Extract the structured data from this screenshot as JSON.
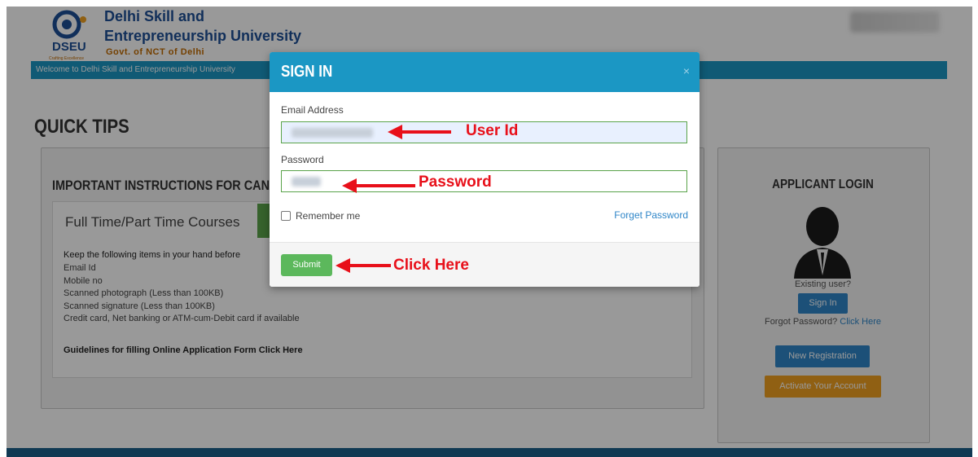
{
  "header": {
    "logo_text": "DSEU",
    "logo_tagline": "Crafting Excellence",
    "brand_line1": "Delhi Skill and",
    "brand_line2": "Entrepreneurship University",
    "brand_line3": "Govt. of NCT of Delhi",
    "welcome": "Welcome to Delhi Skill and Entrepreneurship University"
  },
  "main": {
    "quick_tips": "QUICK TIPS",
    "instructions_title": "IMPORTANT INSTRUCTIONS FOR CANDIDATE",
    "courses_title": "Full Time/Part Time Courses",
    "keep_line": "Keep the following items in your hand before",
    "requirements": [
      "Email Id",
      "Mobile no",
      "Scanned photograph (Less than 100KB)",
      "Scanned signature (Less than 100KB)",
      "Credit card, Net banking or ATM-cum-Debit card if available"
    ],
    "guidelines": "Guidelines for filling Online Application Form Click Here"
  },
  "applicant": {
    "title": "APPLICANT LOGIN",
    "existing": "Existing user?",
    "signin": "Sign In",
    "forgot_prefix": "Forgot Password? ",
    "forgot_link": "Click Here",
    "new_registration": "New Registration",
    "activate": "Activate Your Account"
  },
  "modal": {
    "title": "SIGN IN",
    "close": "×",
    "email_label": "Email Address",
    "password_label": "Password",
    "remember": "Remember me",
    "forget": "Forget Password",
    "submit": "Submit"
  },
  "annotations": {
    "user_id": "User Id",
    "password": "Password",
    "click_here": "Click Here",
    "color": "#e8101a"
  },
  "colors": {
    "header_blue": "#1b97c4",
    "button_blue": "#2f86c8",
    "submit_green": "#5cb85c",
    "activate_orange": "#f0a020"
  }
}
